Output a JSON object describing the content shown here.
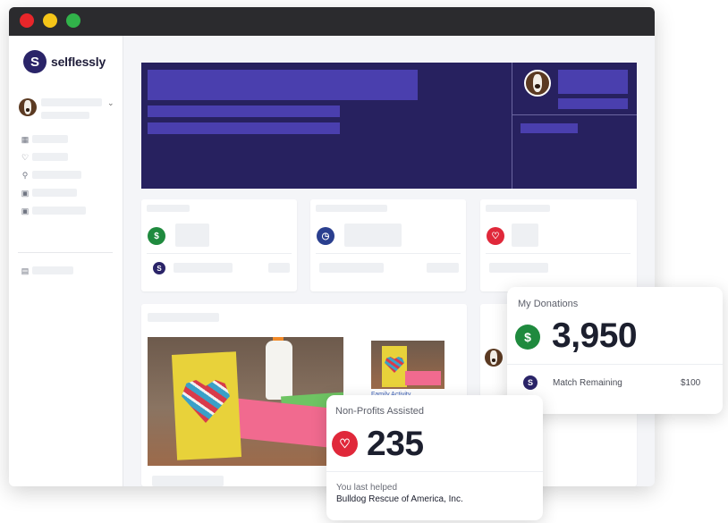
{
  "window": {
    "traffic_lights": [
      "#e8262a",
      "#f5c518",
      "#31b34a"
    ]
  },
  "sidebar": {
    "brand_mark": "S",
    "brand_name": "selflessly",
    "nav_icons": [
      "grid-icon",
      "heart-icon",
      "search-icon",
      "calendar-icon",
      "calendar-icon",
      "document-icon"
    ]
  },
  "stat_cards": {
    "icons": [
      "dollar-icon",
      "clock-icon",
      "heart-icon"
    ],
    "colors": [
      "#1f8a3e",
      "#2a3f8f",
      "#e0283a"
    ]
  },
  "content": {
    "thumbnail_caption": "Family Activity"
  },
  "donations_card": {
    "title": "My Donations",
    "icon_symbol": "$",
    "amount": "3,950",
    "match_label": "Match Remaining",
    "match_value": "$100"
  },
  "nonprofits_card": {
    "title": "Non-Profits Assisted",
    "count": "235",
    "last_helped_label": "You last helped",
    "last_helped_name": "Bulldog Rescue of America, Inc."
  },
  "colors": {
    "brand_navy": "#27215f",
    "donation_green": "#1f8a3e",
    "heart_red": "#e0283a"
  }
}
